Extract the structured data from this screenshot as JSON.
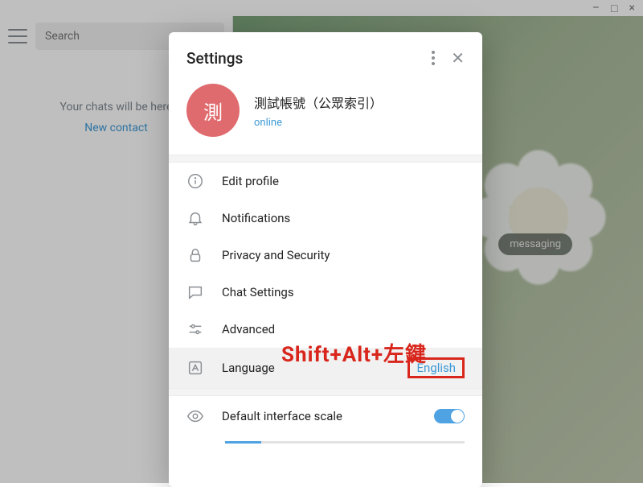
{
  "window": {
    "min": "–",
    "max": "□",
    "close": "×"
  },
  "sidebar": {
    "search_placeholder": "Search",
    "empty_text": "Your chats will be here",
    "new_contact": "New contact"
  },
  "main": {
    "badge": "messaging"
  },
  "settings": {
    "title": "Settings",
    "profile": {
      "avatar_char": "測",
      "display_name": "測試帳號（公眾索引）",
      "status": "online"
    },
    "items": [
      {
        "label": "Edit profile"
      },
      {
        "label": "Notifications"
      },
      {
        "label": "Privacy and Security"
      },
      {
        "label": "Chat Settings"
      },
      {
        "label": "Advanced"
      },
      {
        "label": "Language",
        "value": "English"
      }
    ],
    "scale_label": "Default interface scale"
  },
  "annotation": "Shift+Alt+左鍵"
}
